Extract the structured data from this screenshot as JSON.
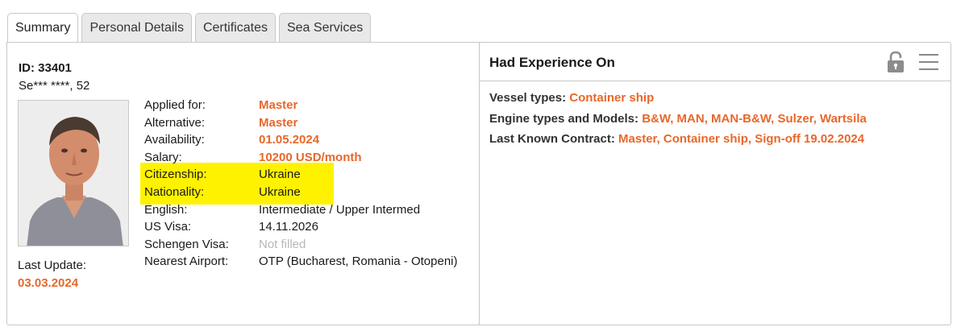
{
  "tabs": [
    {
      "label": "Summary",
      "active": true
    },
    {
      "label": "Personal Details",
      "active": false
    },
    {
      "label": "Certificates",
      "active": false
    },
    {
      "label": "Sea Services",
      "active": false
    }
  ],
  "profile": {
    "id_text": "ID: 33401",
    "name_age": "Se*** ****, 52",
    "last_update_label": "Last Update:",
    "last_update_value": "03.03.2024"
  },
  "details": [
    {
      "label": "Applied for:",
      "value": "Master",
      "style": "orange"
    },
    {
      "label": "Alternative:",
      "value": "Master",
      "style": "orange"
    },
    {
      "label": "Availability:",
      "value": "01.05.2024",
      "style": "orange"
    },
    {
      "label": "Salary:",
      "value": "10200 USD/month",
      "style": "orange"
    },
    {
      "label": "Citizenship:",
      "value": "Ukraine",
      "style": "normal"
    },
    {
      "label": "Nationality:",
      "value": "Ukraine",
      "style": "normal"
    },
    {
      "label": "English:",
      "value": "Intermediate / Upper Intermed",
      "style": "normal"
    },
    {
      "label": "US Visa:",
      "value": "14.11.2026",
      "style": "normal"
    },
    {
      "label": "Schengen Visa:",
      "value": "Not filled",
      "style": "muted"
    },
    {
      "label": "Nearest Airport:",
      "value": "OTP (Bucharest, Romania - Otopeni)",
      "style": "normal"
    }
  ],
  "experience": {
    "title": "Had Experience On",
    "lines": [
      {
        "label": "Vessel types:",
        "value": "Container ship"
      },
      {
        "label": "Engine types and Models:",
        "value": "B&W, MAN, MAN-B&W, Sulzer, Wartsila"
      },
      {
        "label": "Last Known Contract:",
        "value": "Master, Container ship, Sign-off 19.02.2024"
      }
    ]
  },
  "icons": {
    "lock": "lock-icon",
    "menu": "hamburger-menu-icon"
  },
  "colors": {
    "accent": "#e8672a",
    "highlight": "#fff200",
    "muted": "#b8b8b8"
  }
}
